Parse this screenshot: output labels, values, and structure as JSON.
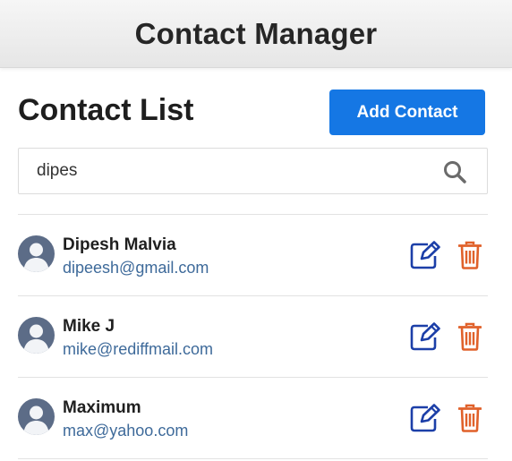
{
  "header": {
    "title": "Contact Manager"
  },
  "list_title": "Contact List",
  "add_button_label": "Add Contact",
  "search": {
    "value": "dipes",
    "icon": "search-icon"
  },
  "colors": {
    "accent": "#1577e4",
    "edit_icon": "#1c3fa8",
    "delete_icon": "#e0612a",
    "email_text": "#3e6a9a",
    "avatar_bg": "#5c6c87"
  },
  "contacts": [
    {
      "name": "Dipesh Malvia",
      "email": "dipeesh@gmail.com"
    },
    {
      "name": "Mike J",
      "email": "mike@rediffmail.com"
    },
    {
      "name": "Maximum",
      "email": "max@yahoo.com"
    }
  ]
}
